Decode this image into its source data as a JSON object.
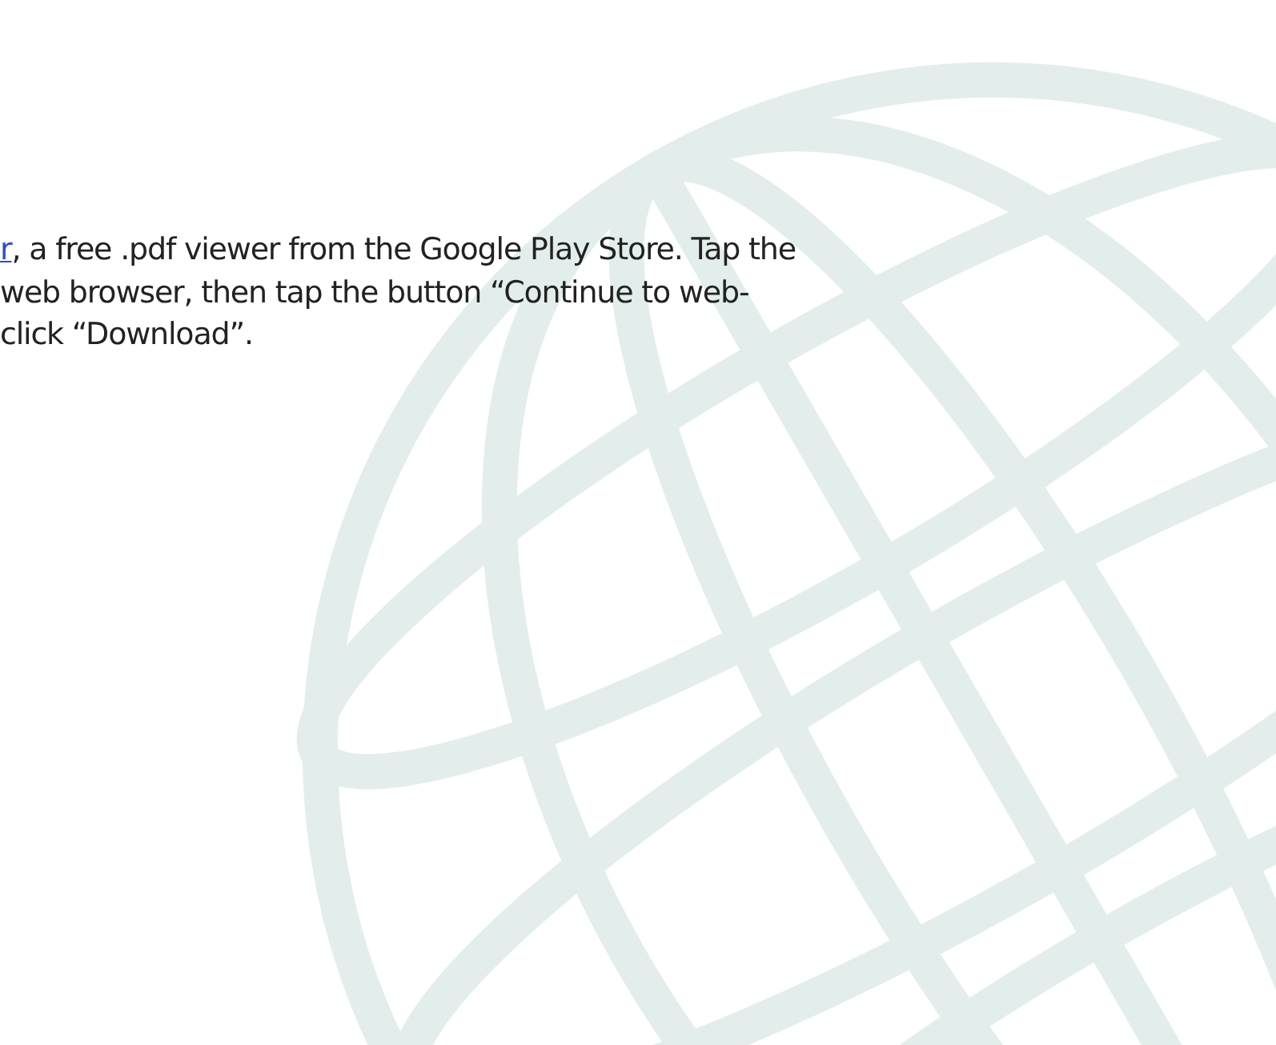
{
  "paragraph": {
    "lines": [
      {
        "link": "r",
        "text": ", a free .pdf viewer from the Google Play Store. Tap the"
      },
      {
        "text": "web browser, then tap the button “Continue to web-"
      },
      {
        "text": "click “Download”."
      }
    ]
  }
}
